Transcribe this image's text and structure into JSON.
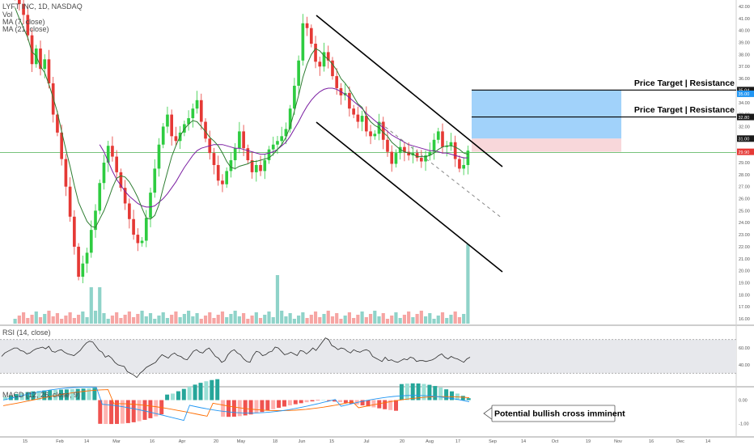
{
  "header": {
    "symbol_line": "LYFT INC, 1D, NASDAQ",
    "vol_label": "Vol",
    "ma7_label": "MA (7, close)",
    "ma21_label": "MA (21, close)"
  },
  "rsi_title": "RSI (14, close)",
  "macd_title": "MACD (12, 26, close, 9)",
  "colors": {
    "up": "#26a69a",
    "down": "#ef5350",
    "candle_up": "#2ecc40",
    "candle_down": "#e53935",
    "ma7": "#2e7d32",
    "ma21": "#7b1fa2",
    "target_zone": "#90caf9",
    "stop_zone": "#f8d7da",
    "support_line": "#4caf50",
    "rsi_band": "#e7e8ec",
    "rsi_line": "#2b2b2b",
    "macd_line": "#2196f3",
    "signal_line": "#ff6d00"
  },
  "annotations": {
    "target_1": "Price Target | Resistance",
    "target_2": "Price Target | Resistance",
    "macd_note": "Potential bullish cross imminent"
  },
  "price_badges": [
    "35.04",
    "35.00",
    "32.80",
    "31.00",
    "29.90"
  ],
  "chart_data": [
    {
      "type": "candlestick",
      "title": "LYFT INC, 1D, NASDAQ",
      "ylim": [
        15.5,
        42.5
      ],
      "yticks": [
        "42.00",
        "41.00",
        "40.00",
        "39.00",
        "38.00",
        "37.00",
        "36.00",
        "35.00",
        "34.00",
        "33.00",
        "32.00",
        "31.00",
        "30.00",
        "29.00",
        "28.00",
        "27.00",
        "26.00",
        "25.00",
        "24.00",
        "23.00",
        "22.00",
        "21.00",
        "20.00",
        "19.00",
        "18.00",
        "17.00",
        "16.00"
      ],
      "x_ticks": [
        "15",
        "Feb",
        "14",
        "Mar",
        "16",
        "Apr",
        "20",
        "May",
        "18",
        "Jun",
        "15",
        "Jul",
        "20",
        "Aug",
        "17",
        "Sep",
        "14",
        "Oct",
        "19",
        "Nov",
        "16",
        "Dec",
        "14"
      ],
      "closes": [
        42.8,
        42.2,
        41.3,
        39.6,
        37.2,
        38.5,
        36.8,
        37.6,
        35.6,
        33.0,
        31.5,
        29.3,
        27.0,
        24.5,
        22.0,
        19.5,
        20.6,
        21.5,
        23.4,
        25.0,
        27.3,
        29.0,
        30.4,
        29.5,
        28.2,
        26.9,
        25.6,
        24.3,
        23.0,
        22.3,
        22.5,
        24.4,
        26.5,
        28.5,
        30.5,
        32.0,
        33.0,
        31.2,
        30.8,
        31.5,
        32.2,
        32.7,
        33.5,
        34.2,
        32.4,
        31.0,
        29.8,
        28.8,
        27.5,
        27.2,
        28.3,
        29.2,
        30.2,
        31.6,
        30.2,
        29.2,
        28.2,
        28.8,
        28.3,
        29.2,
        30.1,
        30.5,
        30.8,
        31.2,
        31.8,
        33.5,
        35.4,
        37.5,
        40.6,
        40.2,
        38.9,
        37.4,
        37.0,
        38.2,
        37.5,
        36.2,
        35.2,
        34.6,
        34.8,
        33.5,
        33.0,
        32.4,
        32.9,
        31.6,
        31.2,
        31.4,
        32.4,
        30.9,
        29.9,
        28.9,
        29.8,
        30.3,
        29.9,
        29.6,
        29.8,
        29.4,
        29.1,
        29.6,
        29.9,
        30.9,
        31.6,
        30.3,
        30.4,
        30.7,
        29.3,
        28.5,
        28.8,
        30.0
      ],
      "ma7": [
        41.9,
        41.0,
        40.2,
        39.4,
        38.2,
        37.9,
        37.0,
        36.5,
        35.5,
        34.4,
        33.2,
        31.6,
        30.1,
        28.7,
        27.1,
        25.7,
        24.9,
        24.1,
        23.7,
        23.6,
        24.3,
        25.0,
        25.9,
        26.9,
        27.7,
        27.9,
        27.8,
        27.4,
        26.8,
        26.1,
        25.2,
        24.4,
        24.3,
        24.6,
        25.5,
        26.9,
        28.2,
        29.5,
        30.4,
        31.2,
        31.8,
        32.2,
        32.5,
        32.4,
        32.0,
        31.6,
        31.1,
        30.8,
        30.4,
        29.8,
        29.1,
        28.6,
        28.5,
        28.7,
        28.8,
        28.9,
        29.1,
        29.1,
        29.2,
        29.3,
        29.4,
        29.7,
        30.1,
        30.5,
        31.1,
        32.0,
        33.3,
        34.6,
        36.1,
        37.2,
        38.0,
        38.5,
        38.3,
        37.9,
        37.6,
        37.2,
        36.7,
        36.0,
        35.6,
        35.1,
        34.5,
        33.9,
        33.6,
        32.9,
        32.4,
        32.1,
        31.9,
        31.5,
        31.2,
        30.7,
        30.4,
        30.1,
        29.9,
        29.8,
        29.7,
        29.5,
        29.5,
        29.5,
        29.6,
        29.8,
        30.1,
        30.3,
        30.4,
        30.4,
        30.3,
        30.1,
        29.8,
        29.7
      ],
      "ma21": [
        null,
        null,
        null,
        null,
        null,
        null,
        null,
        null,
        null,
        null,
        null,
        null,
        null,
        null,
        null,
        null,
        null,
        null,
        null,
        null,
        30.5,
        29.9,
        29.1,
        28.3,
        27.6,
        27.1,
        26.6,
        26.2,
        25.9,
        25.6,
        25.4,
        25.3,
        25.3,
        25.4,
        25.7,
        26.0,
        26.4,
        26.9,
        27.4,
        28.0,
        28.6,
        29.1,
        29.6,
        30.0,
        30.2,
        30.3,
        30.4,
        30.5,
        30.5,
        30.5,
        30.4,
        30.3,
        30.2,
        30.2,
        30.1,
        30.0,
        29.9,
        29.8,
        29.7,
        29.7,
        29.8,
        29.9,
        30.1,
        30.4,
        30.7,
        31.2,
        31.8,
        32.4,
        33.1,
        33.7,
        34.2,
        34.6,
        34.9,
        35.1,
        35.2,
        35.2,
        35.1,
        34.9,
        34.7,
        34.4,
        34.1,
        33.8,
        33.5,
        33.1,
        32.8,
        32.5,
        32.2,
        31.9,
        31.6,
        31.3,
        31.1,
        30.9,
        30.7,
        30.5,
        30.4,
        30.3,
        30.2,
        30.1,
        30.0,
        30.0,
        29.9,
        29.8,
        29.8,
        29.7,
        29.6,
        29.5,
        29.4,
        29.4
      ],
      "volume": [
        1,
        1,
        1,
        1,
        1,
        1,
        1,
        1,
        1,
        1,
        1,
        1,
        1,
        1,
        1,
        1,
        1,
        1,
        1,
        1,
        1,
        1,
        1,
        1,
        1,
        1,
        1,
        1,
        1,
        1,
        1,
        1,
        1,
        1,
        1,
        1,
        1,
        1,
        1,
        1,
        1,
        1,
        1,
        1,
        1,
        1,
        1,
        1,
        1,
        1,
        1,
        1,
        1,
        1,
        1,
        1,
        1,
        1,
        1,
        1,
        1,
        1,
        1,
        1,
        1,
        1,
        1,
        1,
        1,
        1,
        1,
        1,
        1,
        1,
        1,
        1,
        1,
        1,
        1,
        1,
        1,
        1,
        1,
        1,
        1,
        1,
        1,
        1,
        1,
        1,
        1,
        1,
        1,
        1,
        1,
        1,
        1,
        1,
        1,
        1,
        1,
        1,
        1,
        1,
        1,
        1,
        1,
        1
      ]
    },
    {
      "type": "line",
      "title": "RSI (14, close)",
      "ylim": [
        15,
        85
      ],
      "yticks": [
        "60.00",
        "40.00"
      ],
      "band": [
        30,
        70
      ],
      "values": [
        50,
        54,
        56,
        58,
        60,
        60,
        57,
        56,
        53,
        54,
        57,
        59,
        60,
        61,
        59,
        62,
        56,
        55,
        57,
        58,
        55,
        53,
        52,
        51,
        54,
        57,
        62,
        66,
        68,
        67,
        62,
        57,
        55,
        49,
        51,
        48,
        43,
        40,
        39,
        38,
        32,
        30,
        28,
        25,
        30,
        33,
        37,
        39,
        41,
        43,
        48,
        52,
        50,
        48,
        52,
        54,
        51,
        50,
        47,
        46,
        51,
        56,
        58,
        55,
        54,
        58,
        60,
        55,
        50,
        48,
        43,
        45,
        52,
        56,
        58,
        54,
        52,
        47,
        44,
        43,
        51,
        56,
        55,
        51,
        52,
        55,
        56,
        61,
        60,
        56,
        52,
        53,
        55,
        53,
        51,
        57,
        56,
        53,
        56,
        60,
        57,
        62,
        67,
        72,
        70,
        63,
        61,
        58,
        60,
        59,
        56,
        54,
        58,
        56,
        55,
        57,
        58,
        56,
        50,
        48,
        46,
        44,
        49,
        45,
        46,
        44,
        43,
        45,
        47,
        46,
        49,
        48,
        44,
        45,
        45,
        44,
        45,
        46,
        48,
        51,
        53,
        49,
        47,
        50,
        48,
        47,
        45,
        43,
        47,
        49
      ]
    },
    {
      "type": "bar",
      "title": "MACD (12, 26, close, 9)",
      "ylim": [
        -1.5,
        0.5
      ],
      "yticks": [
        "0.00",
        "-1.00"
      ]
    }
  ]
}
